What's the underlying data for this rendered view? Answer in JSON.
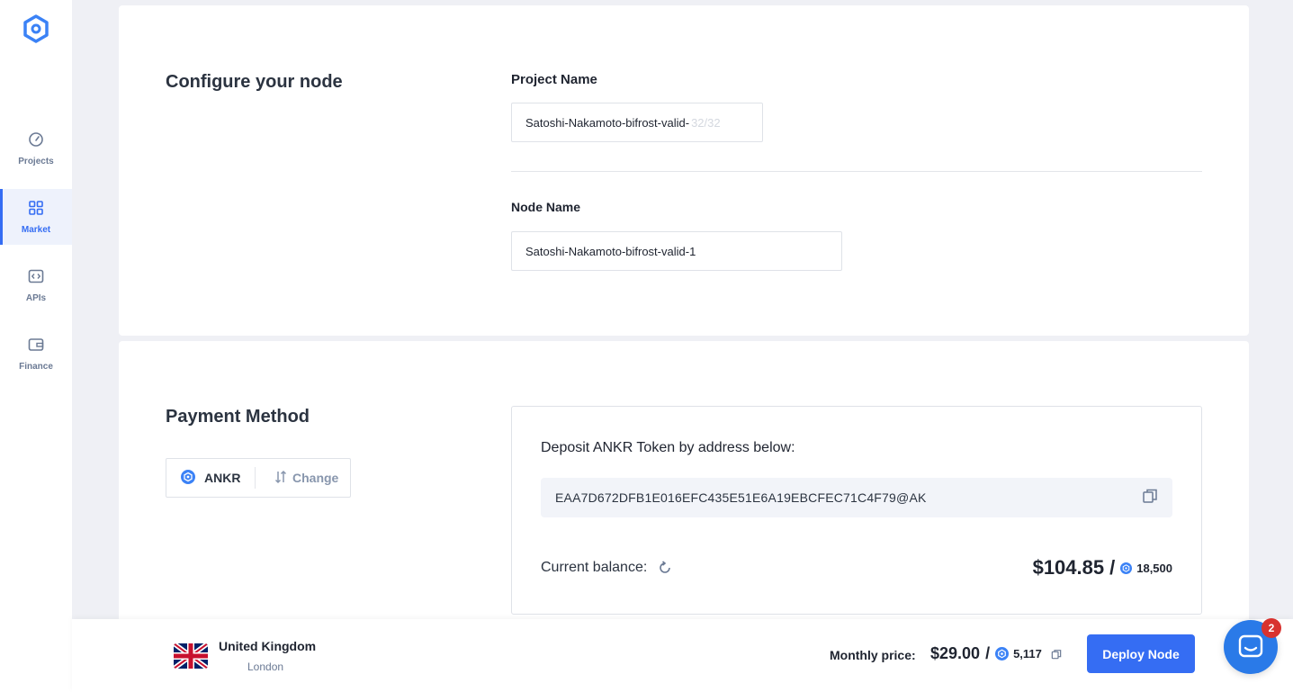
{
  "sidebar": {
    "items": [
      {
        "label": "Projects",
        "icon": "gauge-icon",
        "active": false
      },
      {
        "label": "Market",
        "icon": "grid-icon",
        "active": true
      },
      {
        "label": "APIs",
        "icon": "code-icon",
        "active": false
      },
      {
        "label": "Finance",
        "icon": "wallet-icon",
        "active": false
      }
    ]
  },
  "config": {
    "title": "Configure your node",
    "project_name_label": "Project Name",
    "project_name_value": "Satoshi-Nakamoto-bifrost-valid-",
    "project_name_counter": "32/32",
    "node_name_label": "Node Name",
    "node_name_value": "Satoshi-Nakamoto-bifrost-valid-1"
  },
  "payment": {
    "title": "Payment Method",
    "current_method": "ANKR",
    "change_label": "Change",
    "deposit_title": "Deposit ANKR Token by address below:",
    "address": "EAA7D672DFB1E016EFC435E51E6A19EBCFEC71C4F79@AK",
    "balance_label": "Current balance:",
    "balance_usd": "$104.85",
    "balance_separator": "/",
    "balance_ankr": "18,500"
  },
  "footer": {
    "country": "United Kingdom",
    "city": "London",
    "price_label": "Monthly price:",
    "price_usd": "$29.00",
    "price_separator": "/",
    "price_ankr": "5,117",
    "deploy_label": "Deploy Node"
  },
  "chat": {
    "badge_count": "2"
  },
  "colors": {
    "accent": "#356df3",
    "badge": "#d8322f",
    "chat": "#2a7ae8"
  }
}
